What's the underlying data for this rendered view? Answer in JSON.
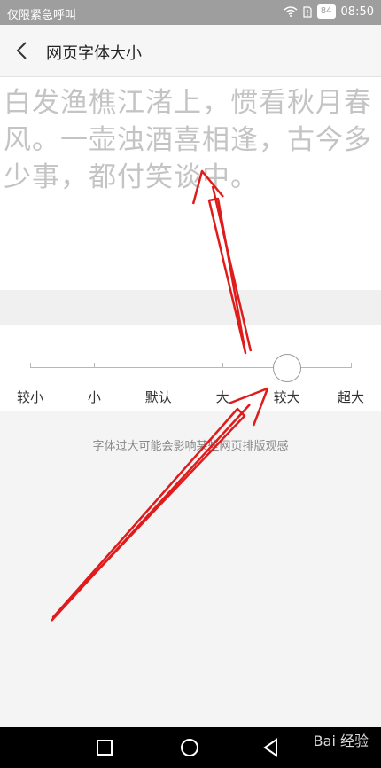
{
  "status": {
    "left_text": "仅限紧急呼叫",
    "battery": "84",
    "time": "08:50"
  },
  "header": {
    "title": "网页字体大小"
  },
  "preview": {
    "text": "白发渔樵江渚上，惯看秋月春风。一壶浊酒喜相逢，古今多少事，都付笑谈中。"
  },
  "slider": {
    "levels": [
      "较小",
      "小",
      "默认",
      "大",
      "较大",
      "超大"
    ],
    "selected_index": 4,
    "selected_label": "较大"
  },
  "hint": {
    "text": "字体过大可能会影响某些网页排版观感"
  },
  "watermark": {
    "text": "Bai 经验"
  },
  "colors": {
    "annotation_arrow": "#e01b1b",
    "preview_text": "#c4c4c4",
    "status_bar": "#9e9e9e"
  }
}
